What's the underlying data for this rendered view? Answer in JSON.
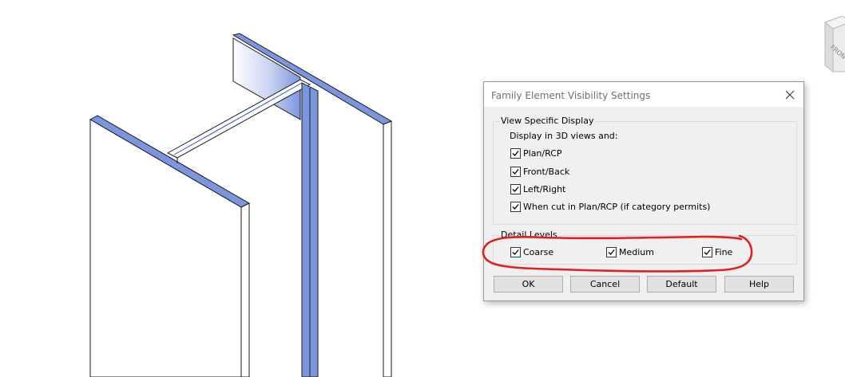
{
  "dialog": {
    "title": "Family Element Visibility Settings",
    "close_icon": "close-icon",
    "view_specific_display": {
      "label": "View Specific Display",
      "sub_label": "Display in 3D views and:",
      "options": [
        {
          "label": "Plan/RCP",
          "checked": true
        },
        {
          "label": "Front/Back",
          "checked": true
        },
        {
          "label": "Left/Right",
          "checked": true
        },
        {
          "label": "When cut in Plan/RCP (if category permits)",
          "checked": true
        }
      ]
    },
    "detail_levels": {
      "label": "Detail Levels",
      "options": [
        {
          "label": "Coarse",
          "checked": true
        },
        {
          "label": "Medium",
          "checked": true
        },
        {
          "label": "Fine",
          "checked": true
        }
      ]
    },
    "buttons": {
      "ok": "OK",
      "cancel": "Cancel",
      "default": "Default",
      "help": "Help"
    }
  },
  "viewcube": {
    "face_label": "FRONT"
  },
  "colors": {
    "selection_blue": "#7b95e0",
    "annotation_red": "#e02020",
    "dialog_bg": "#f0f0f0"
  }
}
